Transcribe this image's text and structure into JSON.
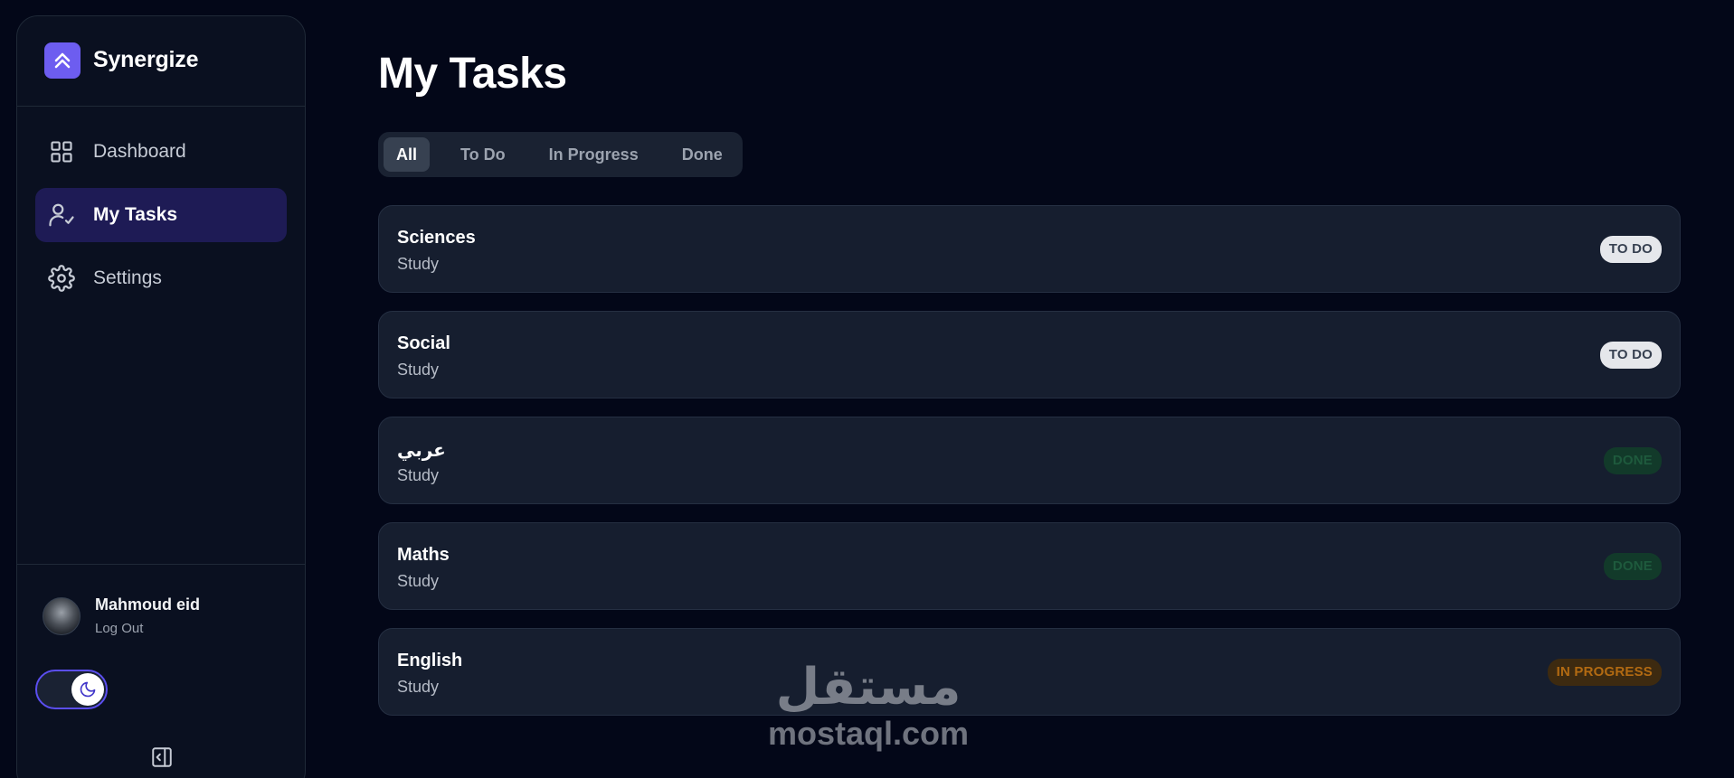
{
  "sidebar": {
    "brand_name": "Synergize",
    "items": [
      {
        "label": "Dashboard",
        "icon": "grid-icon"
      },
      {
        "label": "My Tasks",
        "icon": "user-check-icon",
        "active": true
      },
      {
        "label": "Settings",
        "icon": "gear-icon"
      }
    ],
    "user": {
      "name": "Mahmoud eid",
      "logout_label": "Log Out"
    },
    "theme_toggle": {
      "state": "dark",
      "icon": "moon-icon"
    },
    "collapse_icon": "sidebar-collapse-icon"
  },
  "main": {
    "title": "My Tasks",
    "filters": [
      {
        "label": "All",
        "active": true
      },
      {
        "label": "To Do"
      },
      {
        "label": "In Progress"
      },
      {
        "label": "Done"
      }
    ],
    "tasks": [
      {
        "title": "Sciences",
        "subtitle": "Study",
        "status": "TO DO"
      },
      {
        "title": "Social",
        "subtitle": "Study",
        "status": "TO DO"
      },
      {
        "title": "عربي",
        "subtitle": "Study",
        "status": "DONE"
      },
      {
        "title": "Maths",
        "subtitle": "Study",
        "status": "DONE"
      },
      {
        "title": "English",
        "subtitle": "Study",
        "status": "IN PROGRESS"
      }
    ]
  },
  "watermark": {
    "arabic": "مستقل",
    "latin": "mostaql.com"
  },
  "colors": {
    "background": "#030718",
    "sidebar": "#0a1020",
    "accent": "#6d5df0",
    "active_nav": "#1e1b55",
    "card": "#161e2f"
  }
}
